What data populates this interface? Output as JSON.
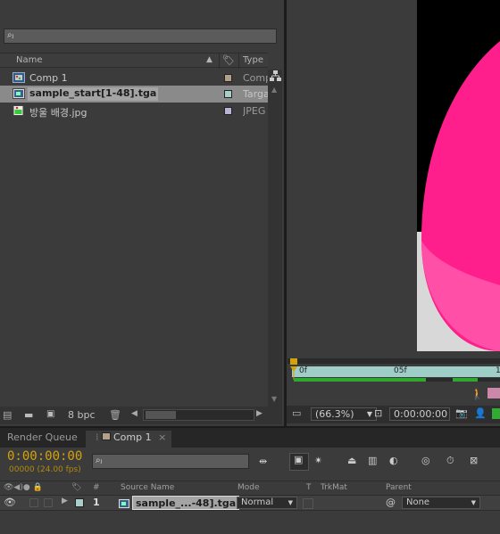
{
  "project": {
    "search_placeholder": "⌕ⱼ",
    "columns": {
      "name": "Name",
      "type": "Type"
    },
    "items": [
      {
        "name": "Comp 1",
        "type": "Comp",
        "label_color": "#b3a08a",
        "icon": "composition-icon"
      },
      {
        "name": "sample_start[1-48].tga",
        "type": "Targa",
        "label_color": "#a9cdc8",
        "icon": "footage-sequence-icon"
      },
      {
        "name": "방울 배경.jpg",
        "type": "JPEG",
        "label_color": "#b7b4d8",
        "icon": "image-file-icon"
      }
    ],
    "bpc": "8 bpc"
  },
  "viewer": {
    "zoom": "(66.3%)",
    "timecode": "0:00:00:00",
    "ruler": {
      "start": "0f",
      "mid": "05f",
      "end": "1"
    },
    "colors": {
      "shape": "#ff1f8c",
      "shape_light": "#ff4fa6",
      "bg": "#000000"
    }
  },
  "tabs": {
    "render_queue": "Render Queue",
    "comp": "Comp 1"
  },
  "timeline": {
    "timecode": "0:00:00:00",
    "frames_fps": "00000 (24.00 fps)",
    "columns": {
      "num": "#",
      "source_name": "Source Name",
      "mode": "Mode",
      "t": "T",
      "trkmat": "TrkMat",
      "parent": "Parent"
    },
    "layer": {
      "index": "1",
      "name": "sample_...-48].tga",
      "mode": "Normal",
      "parent": "None"
    }
  },
  "accent": "#d4a30a"
}
